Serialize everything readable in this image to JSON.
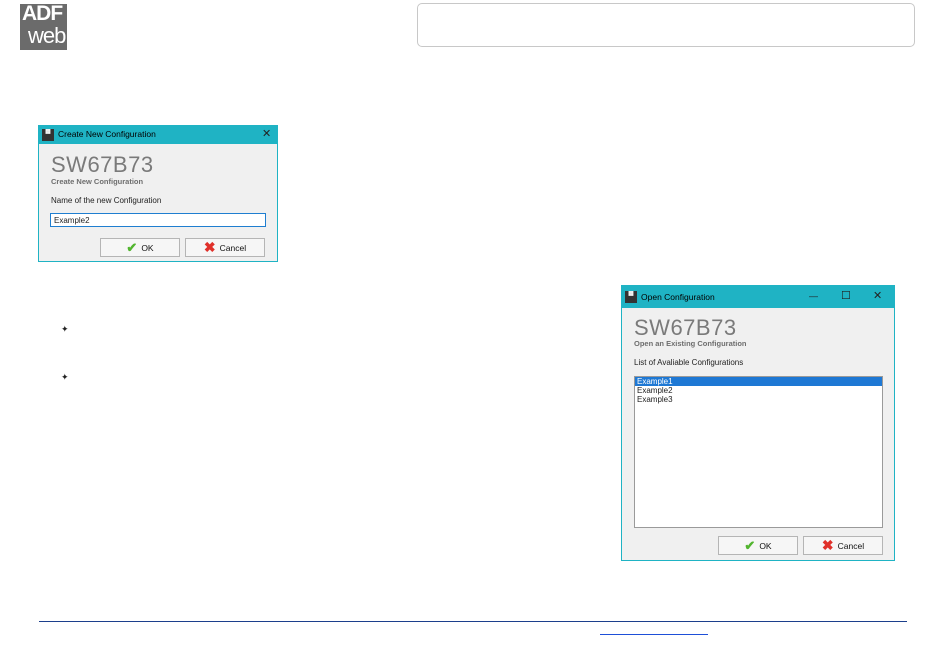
{
  "logo": {
    "line1": "ADF",
    "line2": "web"
  },
  "new_config_dialog": {
    "title": "Create New Configuration",
    "close_symbol": "✕",
    "heading": "SW67B73",
    "subheading": "Create New Configuration",
    "field_label": "Name of the new Configuration",
    "field_value": "Example2",
    "ok_label": "OK",
    "cancel_label": "Cancel"
  },
  "open_config_dialog": {
    "title": "Open Configuration",
    "minimize_symbol": "—",
    "maximize_symbol": "☐",
    "close_symbol": "✕",
    "heading": "SW67B73",
    "subheading": "Open an Existing Configuration",
    "list_label": "List of Avaliable Configurations",
    "items": [
      "Example1",
      "Example2",
      "Example3"
    ],
    "selected_index": 0,
    "ok_label": "OK",
    "cancel_label": "Cancel"
  },
  "bullets": [
    "✦",
    "✦"
  ],
  "icons": {
    "ok": "checkmark-icon",
    "cancel": "cross-icon",
    "app": "app-icon"
  },
  "colors": {
    "titlebar": "#1fb3c4",
    "selection": "#1e78d4",
    "footer_line": "#1c3f8c"
  }
}
